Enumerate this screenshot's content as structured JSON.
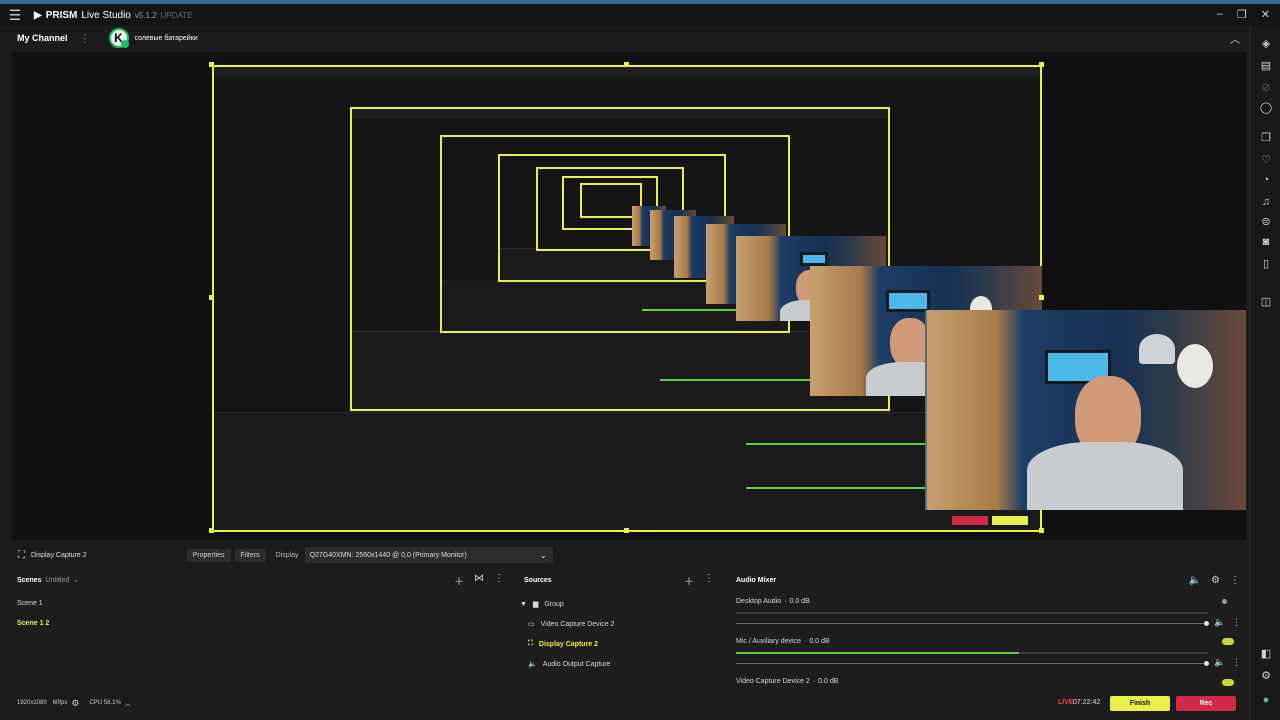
{
  "titlebar": {
    "brand": "PRISM",
    "app_name": "Live Studio",
    "version": "v5.1.2",
    "update_label": "UPDATE"
  },
  "channel": {
    "my_channel": "My Channel",
    "channel_name": "солевые батарейки",
    "avatar_letter": "K"
  },
  "source_bar": {
    "selected_source": "Display Capture 2",
    "properties_label": "Properties",
    "filters_label": "Filters",
    "display_label": "Display",
    "display_value": "Q27G40XMN: 2560x1440 @ 0,0 (Primary Monitor)"
  },
  "scenes": {
    "title": "Scenes",
    "collection": "Untitled",
    "items": [
      {
        "label": "Scene 1",
        "active": false
      },
      {
        "label": "Scene 1 2",
        "active": true
      }
    ]
  },
  "sources": {
    "title": "Sources",
    "items": [
      {
        "label": "Group",
        "active": false
      },
      {
        "label": "Video Capture Device 2",
        "active": false
      },
      {
        "label": "Display Capture 2",
        "active": true
      },
      {
        "label": "Audio Output Capture",
        "active": false
      }
    ]
  },
  "audio_mixer": {
    "title": "Audio Mixer",
    "channels": [
      {
        "label": "Desktop Audio",
        "db": "0.0 dB",
        "level": 0.0
      },
      {
        "label": "Mic / Auxiliary device",
        "db": "0.0 dB",
        "level": 0.6
      },
      {
        "label": "Video Capture Device 2",
        "db": "0.0 dB",
        "level": 0.0
      }
    ]
  },
  "status": {
    "resolution": "1920x1080",
    "fps": "60fps",
    "cpu": "CPU 58.1%",
    "live_label": "LIVE",
    "timer": "07:22:42",
    "finish_label": "Finish",
    "rec_label": "Rec"
  },
  "colors": {
    "accent": "#e8f04a",
    "rec": "#d02a48",
    "meter": "#5fd03a",
    "live": "#ff3a4a"
  }
}
